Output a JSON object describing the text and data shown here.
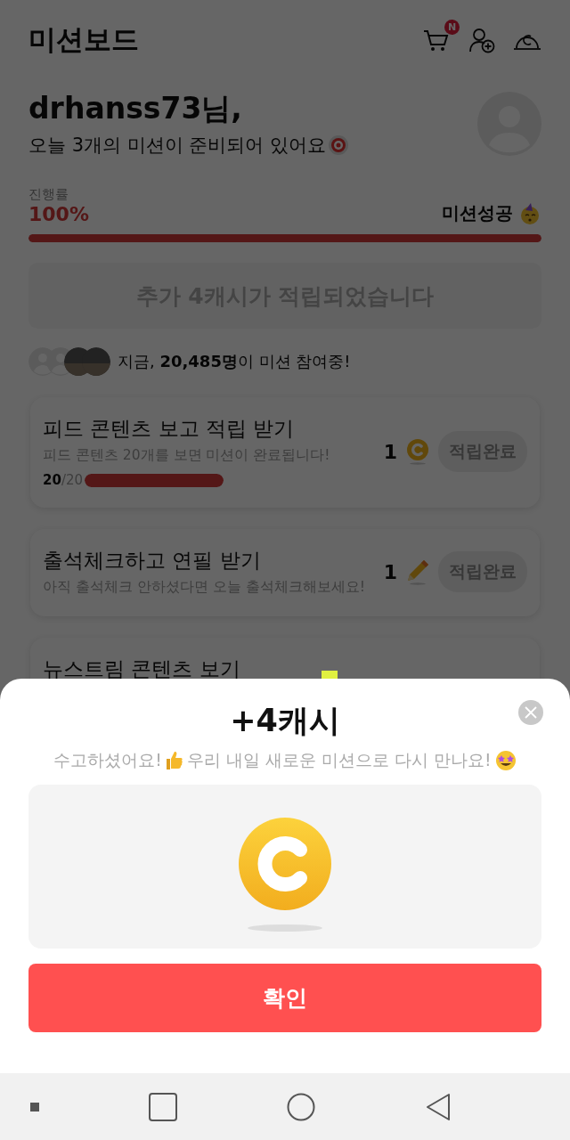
{
  "header": {
    "title": "미션보드",
    "cart_badge": "N"
  },
  "user": {
    "name": "drhanss73님,",
    "subtitle": "오늘 3개의 미션이 준비되어 있어요"
  },
  "progress": {
    "label": "진행률",
    "value": "100%",
    "status": "미션성공",
    "level": 1
  },
  "banner": "추가 4캐시가 적립되었습니다",
  "participants": "지금, **20,485명**이 미션 참여중!",
  "missions": [
    {
      "title": "피드 콘텐츠 보고 적립 받기",
      "description": "피드 콘텐츠 20개를 보면 미션이 완료됩니다!",
      "count": "20",
      "total": "/20",
      "level": 1,
      "reward": "1",
      "kind": "coin",
      "button": "적립완료",
      "completed": true
    },
    {
      "title": "출석체크하고 연필 받기",
      "description": "아직 출석체크 안하셨다면 오늘 출석체크해보세요!",
      "reward": "1",
      "kind": "pencil",
      "button": "적립완료",
      "completed": true
    },
    {
      "title": "뉴스트림 콘텐츠 보기"
    }
  ],
  "popup": {
    "title": "+4캐시",
    "message": [
      "수고하셨어요!",
      "우리 내일 새로운 미션으로 다시 만나요!"
    ],
    "button": "확인"
  }
}
